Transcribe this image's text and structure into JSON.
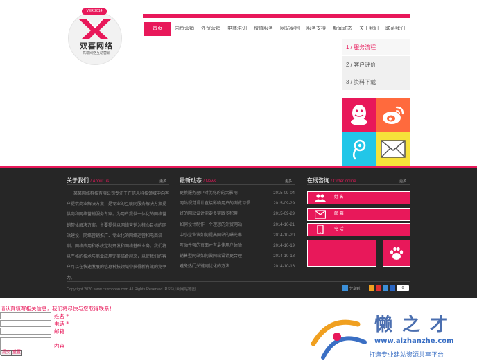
{
  "logo": {
    "version": "VER 2014",
    "name": "双喜网络",
    "tagline": "高端网络互动营销"
  },
  "nav": {
    "items": [
      "首页",
      "内贸营销",
      "外贸营销",
      "电商培训",
      "增值服务",
      "网站案例",
      "服务支持",
      "新闻动态",
      "关于我们",
      "联系我们"
    ],
    "active_index": 0
  },
  "side_menu": {
    "items": [
      "1 / 服务流程",
      "2 / 客户评价",
      "3 / 资料下载"
    ],
    "active_index": 0
  },
  "social": {
    "tiles": [
      "qq-icon",
      "weibo-icon",
      "tencent-weibo-icon",
      "mail-icon"
    ]
  },
  "about": {
    "title": "关于我们",
    "title_en": "/ About us",
    "more": "更多",
    "text": "某某网络科技有限公司专注于在信息科技领域中向客户提供商业解决方案，是专业的互联网服务解决方案提供商和网络营销服务专家。为用户提供一体化的网络营销整体解决方案。主要提供以网络营销为核心目标的网站建设、网络营销推广、专业化的网络运营和电商培训。网络应用和系统定制开发和网络基础业务。我们将以严格的技术与商业应用完美结合起来，以使我们的客户可以在快速发展的信息科技领域中获得新有效的竞争力。"
  },
  "news": {
    "title": "最新动态",
    "title_en": "/ News",
    "more": "更多",
    "rows": [
      {
        "title": "更换服务器IP对优化的的大影响",
        "date": "2015-09-04"
      },
      {
        "title": "网站视觉设计直接影响用户的浏览习惯",
        "date": "2015-09-29"
      },
      {
        "title": "好的网站设计需要多实践多积累",
        "date": "2015-09-29"
      },
      {
        "title": "如何设计制作一个理想的外贸网站",
        "date": "2014-10-21"
      },
      {
        "title": "中小企业该如何提高网站的曝光率",
        "date": "2014-10-20"
      },
      {
        "title": "互动性强的页面才有最佳用户体验",
        "date": "2014-10-19"
      },
      {
        "title": "销售型网站如何做网站设计更合理",
        "date": "2014-10-18"
      },
      {
        "title": "避免热门关键词优化的方法",
        "date": "2014-10-16"
      }
    ]
  },
  "online": {
    "title": "在线咨询",
    "title_en": "/ Order online",
    "more": "更多",
    "contacts": [
      {
        "label": "姓 名",
        "icon": "people-icon"
      },
      {
        "label": "邮 箱",
        "icon": "mail-icon"
      },
      {
        "label": "电 话",
        "icon": "phone-icon"
      }
    ]
  },
  "footer": {
    "copyright": "Copyright 2020 www.csxmoban.com All Rights Reserved.  RSS订阅网站地图",
    "share_label": "分享到：",
    "share_count": "0"
  },
  "form": {
    "heading": "请认真填写相关信息，我们将尽快与您取得联系！",
    "name_label": "姓名 *",
    "phone_label": "电话 *",
    "email_label": "邮箱",
    "content_label": "内容",
    "submit_label": "提交",
    "reset_label": "重置"
  },
  "watermark": {
    "title": "懒之才",
    "url": "www.aizhanzhe.com",
    "tagline": "打造专业建站资源共享平台"
  },
  "colors": {
    "accent": "#e8185a",
    "dark_band": "#262626"
  }
}
